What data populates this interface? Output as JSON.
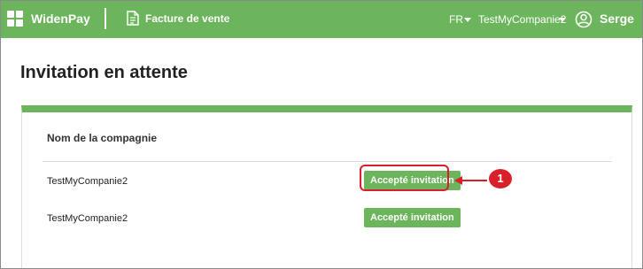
{
  "colors": {
    "brand": "#6cb55c",
    "callout": "#d8202a"
  },
  "topbar": {
    "brand_name": "WidenPay",
    "logo_icon": "grid-logo-icon",
    "module_icon": "document-icon",
    "module_label": "Facture de vente",
    "language": "FR",
    "company": "TestMyCompanie2",
    "user_icon": "user-circle-icon",
    "user_name": "Serge"
  },
  "page": {
    "title": "Invitation en attente"
  },
  "table": {
    "column_header": "Nom de la compagnie",
    "rows": [
      {
        "company": "TestMyCompanie2",
        "action": "Accepté invitation"
      },
      {
        "company": "TestMyCompanie2",
        "action": "Accepté invitation"
      }
    ]
  },
  "annotation": {
    "number": "1"
  }
}
